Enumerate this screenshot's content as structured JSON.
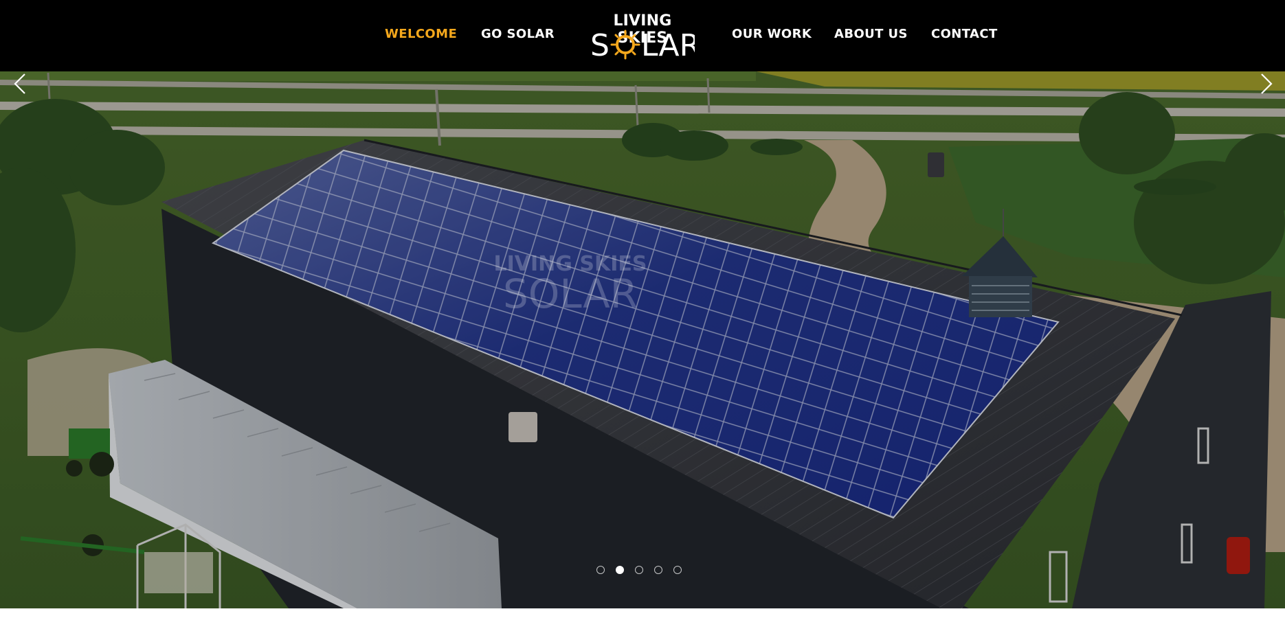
{
  "brand": {
    "logo_top": "LIVING SKIES",
    "logo_bottom": "SOLAR",
    "accent_color": "#f5a81c"
  },
  "nav": {
    "welcome": "WELCOME",
    "go_solar": "GO SOLAR",
    "our_work": "OUR WORK",
    "about_us": "ABOUT US",
    "contact": "CONTACT",
    "active_item": "WELCOME"
  },
  "hero": {
    "image_subject": "aerial view of solar panels on a farm shop roof",
    "watermark_top": "LIVING SKIES",
    "watermark_bottom": "SOLAR",
    "prev_icon": "chevron-left-icon",
    "next_icon": "chevron-right-icon"
  },
  "carousel": {
    "slide_count": 5,
    "active_index": 2
  }
}
